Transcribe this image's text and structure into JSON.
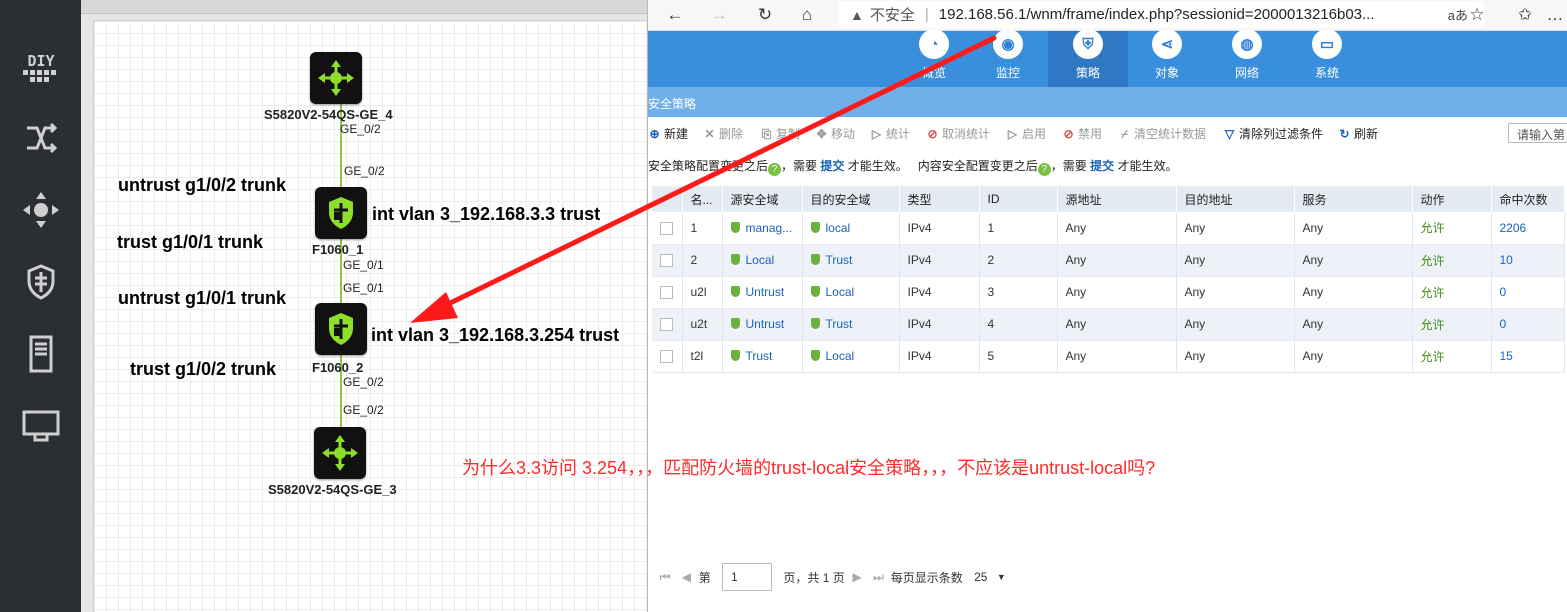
{
  "sidebar": {
    "items": [
      {
        "icon": "diy-icon"
      },
      {
        "icon": "switch-icon"
      },
      {
        "icon": "router-icon"
      },
      {
        "icon": "firewall-icon"
      },
      {
        "icon": "server-icon"
      },
      {
        "icon": "monitor-icon"
      }
    ]
  },
  "topology": {
    "devices": [
      {
        "name": "S5820V2-54QS-GE_4",
        "type": "switch"
      },
      {
        "name": "F1060_1",
        "type": "firewall"
      },
      {
        "name": "F1060_2",
        "type": "firewall"
      },
      {
        "name": "S5820V2-54QS-GE_3",
        "type": "switch"
      }
    ],
    "ports": [
      "GE_0/2",
      "GE_0/2",
      "GE_0/1",
      "GE_0/1",
      "GE_0/2",
      "GE_0/2"
    ],
    "notes": {
      "fw1_top": "untrust g1/0/2 trunk",
      "fw1_bottom": "trust g1/0/1 trunk",
      "fw1_right": "int vlan 3_192.168.3.3 trust",
      "fw2_top": "untrust g1/0/1 trunk",
      "fw2_bottom": "trust g1/0/2 trunk",
      "fw2_right": "int vlan 3_192.168.3.254 trust"
    }
  },
  "browser": {
    "insecure_label": "不安全",
    "url": "192.168.56.1/wnm/frame/index.php?sessionid=2000013216b03...",
    "read_aloud": "aあ"
  },
  "topnav": [
    {
      "label": "概览",
      "icon": "gauge-icon"
    },
    {
      "label": "监控",
      "icon": "camera-icon"
    },
    {
      "label": "策略",
      "icon": "shield-icon",
      "active": true
    },
    {
      "label": "对象",
      "icon": "share-icon"
    },
    {
      "label": "网络",
      "icon": "globe-icon"
    },
    {
      "label": "系统",
      "icon": "monitor-icon"
    }
  ],
  "page": {
    "title": "安全策略",
    "toolbar": {
      "new": "新建",
      "delete": "删除",
      "copy": "复制",
      "move": "移动",
      "stats": "统计",
      "cancel_stats": "取消统计",
      "enable": "启用",
      "disable": "禁用",
      "clear_stats": "清空统计数据",
      "clear_filter": "清除列过滤条件",
      "refresh": "刷新",
      "search_placeholder": "请输入第"
    },
    "notice": {
      "part1": "安全策略配置变更之后",
      "part2": "，需要",
      "submit": "提交",
      "part3": "才能生效。",
      "part4": "内容安全配置变更之后",
      "part5": "，需要",
      "part6": "才能生效。"
    }
  },
  "table": {
    "columns": [
      "名...",
      "源安全域",
      "目的安全域",
      "类型",
      "ID",
      "源地址",
      "目的地址",
      "服务",
      "动作",
      "命中次数"
    ],
    "rows": [
      {
        "name": "1",
        "src": "manag...",
        "dst": "local",
        "type": "IPv4",
        "id": "1",
        "saddr": "Any",
        "daddr": "Any",
        "svc": "Any",
        "action": "允许",
        "hits": "2206"
      },
      {
        "name": "2",
        "src": "Local",
        "dst": "Trust",
        "type": "IPv4",
        "id": "2",
        "saddr": "Any",
        "daddr": "Any",
        "svc": "Any",
        "action": "允许",
        "hits": "10"
      },
      {
        "name": "u2l",
        "src": "Untrust",
        "dst": "Local",
        "type": "IPv4",
        "id": "3",
        "saddr": "Any",
        "daddr": "Any",
        "svc": "Any",
        "action": "允许",
        "hits": "0"
      },
      {
        "name": "u2t",
        "src": "Untrust",
        "dst": "Trust",
        "type": "IPv4",
        "id": "4",
        "saddr": "Any",
        "daddr": "Any",
        "svc": "Any",
        "action": "允许",
        "hits": "0"
      },
      {
        "name": "t2l",
        "src": "Trust",
        "dst": "Local",
        "type": "IPv4",
        "id": "5",
        "saddr": "Any",
        "daddr": "Any",
        "svc": "Any",
        "action": "允许",
        "hits": "15"
      }
    ]
  },
  "pager": {
    "page_prefix": "第",
    "page_value": "1",
    "page_suffix": "页，共 1 页",
    "per_page_label": "每页显示条数",
    "per_page_value": "25"
  },
  "annotation": {
    "question": "为什么3.3访问 3.254，，，匹配防火墙的trust-local安全策略，，，不应该是untrust-local吗?"
  },
  "colors": {
    "nav_blue": "#3a8fdc",
    "arrow_red": "#ff1a1a",
    "link_green": "#8dc63f"
  }
}
